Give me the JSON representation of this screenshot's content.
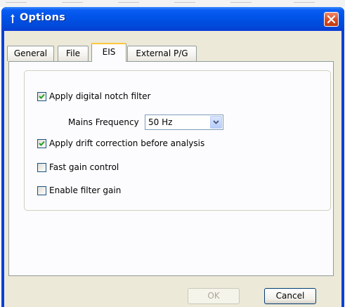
{
  "window": {
    "title": "Options"
  },
  "tabs": [
    {
      "label": "General",
      "active": false
    },
    {
      "label": "File",
      "active": false
    },
    {
      "label": "EIS",
      "active": true
    },
    {
      "label": "External P/G",
      "active": false
    }
  ],
  "eis": {
    "notch_filter": {
      "label": "Apply digital notch filter",
      "checked": true
    },
    "mains_frequency": {
      "label": "Mains Frequency",
      "value": "50 Hz"
    },
    "drift_correction": {
      "label": "Apply drift correction before analysis",
      "checked": true
    },
    "fast_gain": {
      "label": "Fast gain control",
      "checked": false
    },
    "filter_gain": {
      "label": "Enable filter gain",
      "checked": false
    }
  },
  "buttons": {
    "ok_label": "OK",
    "ok_enabled": false,
    "cancel_label": "Cancel"
  },
  "colors": {
    "titlebar": "#0053e7",
    "dialog_bg": "#ece9d8",
    "active_tab_accent": "#ffc83c",
    "close_button": "#d9491f"
  },
  "icons": [
    "app-icon",
    "close-icon",
    "checkmark-icon",
    "chevron-down-icon"
  ]
}
